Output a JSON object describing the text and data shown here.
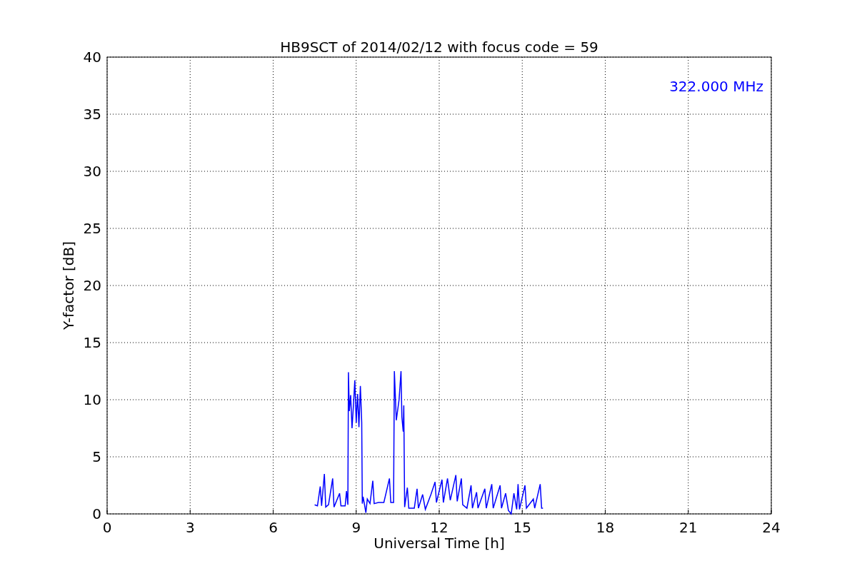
{
  "chart_data": {
    "type": "line",
    "title": "HB9SCT of 2014/02/12 with focus code = 59",
    "xlabel": "Universal Time [h]",
    "ylabel": "Y-factor [dB]",
    "xlim": [
      0,
      24
    ],
    "ylim": [
      0,
      40
    ],
    "xticks": [
      0,
      3,
      6,
      9,
      12,
      15,
      18,
      21,
      24
    ],
    "yticks": [
      0,
      5,
      10,
      15,
      20,
      25,
      30,
      35,
      40
    ],
    "x": [
      7.5,
      7.6,
      7.7,
      7.75,
      7.85,
      7.9,
      8.0,
      8.15,
      8.2,
      8.4,
      8.45,
      8.6,
      8.65,
      8.7,
      8.72,
      8.75,
      8.8,
      8.85,
      8.9,
      8.95,
      9.0,
      9.05,
      9.1,
      9.15,
      9.2,
      9.22,
      9.25,
      9.3,
      9.35,
      9.4,
      9.5,
      9.6,
      9.65,
      9.8,
      10.0,
      10.2,
      10.25,
      10.35,
      10.38,
      10.45,
      10.55,
      10.62,
      10.65,
      10.7,
      10.72,
      10.75,
      10.85,
      10.9,
      11.1,
      11.2,
      11.25,
      11.4,
      11.5,
      11.7,
      11.85,
      11.9,
      12.1,
      12.15,
      12.3,
      12.4,
      12.6,
      12.65,
      12.8,
      12.85,
      13.0,
      13.15,
      13.2,
      13.35,
      13.4,
      13.65,
      13.7,
      13.9,
      13.95,
      14.2,
      14.25,
      14.4,
      14.5,
      14.6,
      14.7,
      14.8,
      14.85,
      14.9,
      15.1,
      15.15,
      15.4,
      15.45,
      15.65,
      15.7,
      15.75
    ],
    "series": [
      {
        "name": "322.000 MHz",
        "color": "#0000ff",
        "values": [
          0.8,
          0.7,
          2.4,
          0.7,
          3.5,
          0.6,
          0.8,
          3.1,
          0.6,
          1.8,
          0.7,
          0.7,
          2.0,
          0.8,
          12.4,
          9,
          10.4,
          7.5,
          9.5,
          11.7,
          8,
          10.5,
          7.6,
          11.2,
          8,
          0.9,
          1.5,
          0.8,
          0.1,
          1.3,
          0.9,
          2.9,
          0.9,
          1.0,
          1.0,
          3.1,
          1.0,
          1.0,
          12.5,
          8.2,
          10,
          12.5,
          8.5,
          7.2,
          9.5,
          0.6,
          2.3,
          0.5,
          0.5,
          2.2,
          0.5,
          1.7,
          0.4,
          1.7,
          2.8,
          1.0,
          3.0,
          1.0,
          3.1,
          1.2,
          3.4,
          1.1,
          3.1,
          0.8,
          0.5,
          2.5,
          0.5,
          1.9,
          0.5,
          2.2,
          0.5,
          2.6,
          0.5,
          2.5,
          0.5,
          1.8,
          0.3,
          0.0,
          1.8,
          0.4,
          2.6,
          0.4,
          2.5,
          0.5,
          1.3,
          0.5,
          2.6,
          0.5,
          0.5
        ]
      }
    ],
    "grid": true
  }
}
